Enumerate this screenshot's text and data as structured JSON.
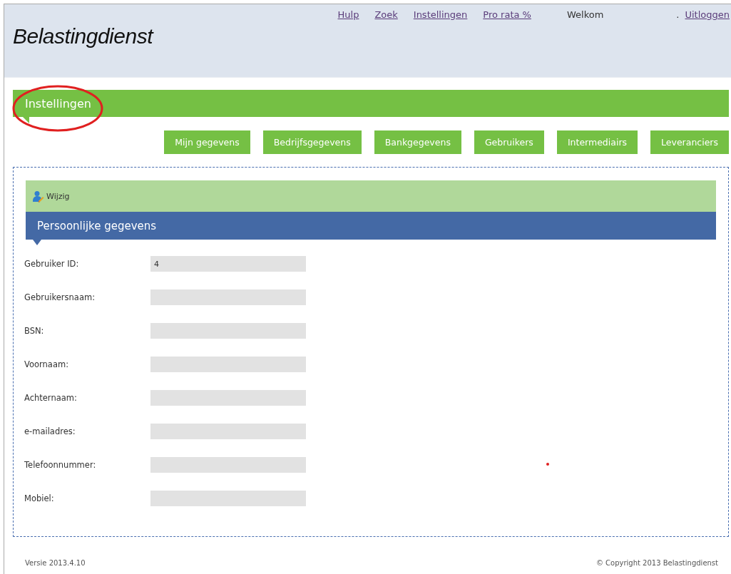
{
  "header": {
    "logo": "Belastingdienst",
    "links": [
      "Hulp",
      "Zoek",
      "Instellingen",
      "Pro rata %"
    ],
    "welcome": "Welkom",
    "separator": ".",
    "logout": "Uitloggen"
  },
  "page_title": "Instellingen",
  "tabs": [
    "Mijn gegevens",
    "Bedrijfsgegevens",
    "Bankgegevens",
    "Gebruikers",
    "Intermediairs",
    "Leveranciers"
  ],
  "toolbar": {
    "edit": "Wijzig"
  },
  "section_title": "Persoonlijke gegevens",
  "fields": [
    {
      "label": "Gebruiker ID:",
      "value": "4"
    },
    {
      "label": "Gebruikersnaam:"
    },
    {
      "label": "BSN:"
    },
    {
      "label": "Voornaam:"
    },
    {
      "label": "Achternaam:"
    },
    {
      "label": "e-mailadres:"
    },
    {
      "label": "Telefoonnummer:"
    },
    {
      "label": "Mobiel:"
    }
  ],
  "footer": {
    "version": "Versie 2013.4.10",
    "copyright": "© Copyright 2013 Belastingdienst"
  }
}
